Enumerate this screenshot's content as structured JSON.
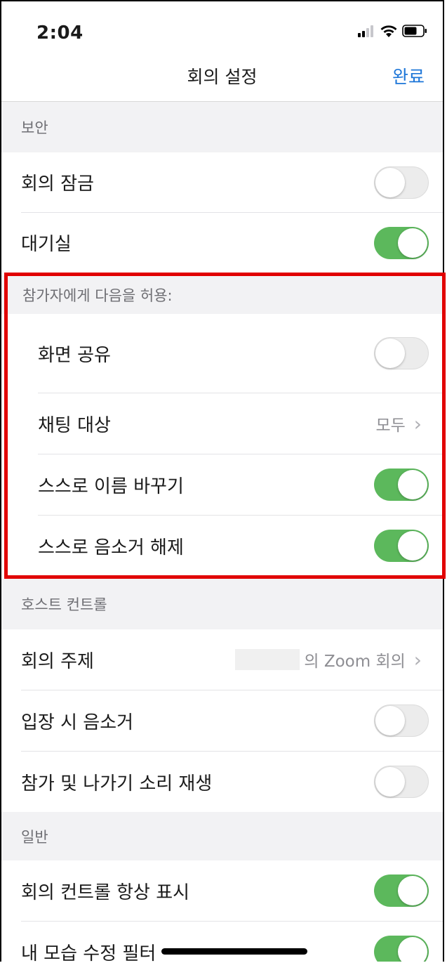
{
  "status": {
    "time": "2:04"
  },
  "nav": {
    "title": "회의 설정",
    "done_label": "완료"
  },
  "colors": {
    "accent": "#1d76d8",
    "toggle_on": "#5cb85c",
    "highlight": "#e10000"
  },
  "sections": {
    "security": {
      "header": "보안",
      "lock": {
        "label": "회의 잠금",
        "on": false
      },
      "waiting_room": {
        "label": "대기실",
        "on": true
      }
    },
    "participants": {
      "header": "참가자에게 다음을 허용:",
      "screen_share": {
        "label": "화면 공유",
        "on": false
      },
      "chat": {
        "label": "채팅 대상",
        "value": "모두"
      },
      "rename": {
        "label": "스스로 이름 바꾸기",
        "on": true
      },
      "unmute": {
        "label": "스스로 음소거 해제",
        "on": true
      }
    },
    "host": {
      "header": "호스트 컨트롤",
      "topic": {
        "label": "회의 주제",
        "value": "의 Zoom 회의"
      },
      "mute_entry": {
        "label": "입장 시 음소거",
        "on": false
      },
      "chime": {
        "label": "참가 및 나가기 소리 재생",
        "on": false
      }
    },
    "general": {
      "header": "일반",
      "always_controls": {
        "label": "회의 컨트롤 항상 표시",
        "on": true
      },
      "touch_up": {
        "label": "내 모습 수정 필터",
        "on": true
      }
    }
  }
}
